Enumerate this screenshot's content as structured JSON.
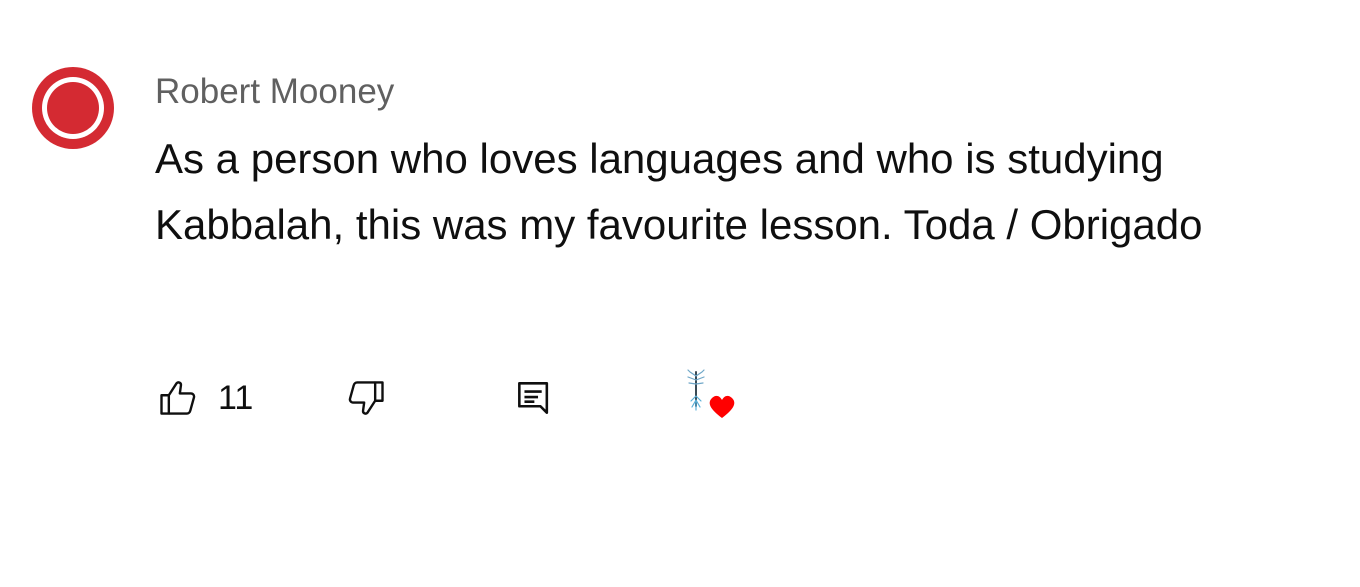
{
  "comment": {
    "author": "Robert Mooney",
    "text": "As a person who loves languages and who is studying Kabbalah, this was my favourite lesson. Toda / Obrigado",
    "avatar_icon": "red-ring-avatar",
    "avatar_color": "#d42a32"
  },
  "actions": {
    "like_icon": "thumbs-up-icon",
    "like_count": "11",
    "dislike_icon": "thumbs-down-icon",
    "reply_icon": "reply-icon",
    "creator_reaction_icon": "tree-heart-icon",
    "heart_color": "#ff0000"
  }
}
